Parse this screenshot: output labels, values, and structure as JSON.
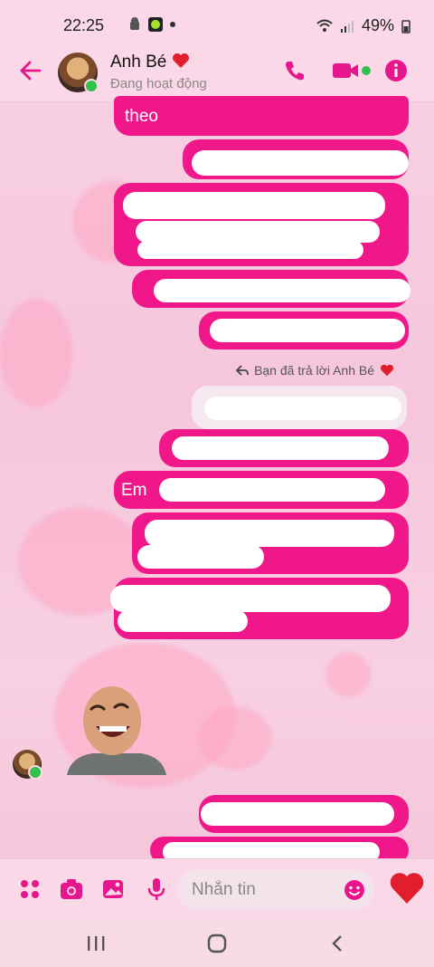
{
  "status_bar": {
    "time": "22:25",
    "battery": "49%"
  },
  "header": {
    "contact_name": "Anh Bé",
    "contact_status": "Đang hoạt động"
  },
  "messages": {
    "m1_text": "theo",
    "m6_text": "Em",
    "reply_note": "Bạn đã trả lời Anh Bé"
  },
  "composer": {
    "placeholder": "Nhắn tin"
  },
  "colors": {
    "accent": "#f0178a",
    "online": "#31c24d"
  }
}
